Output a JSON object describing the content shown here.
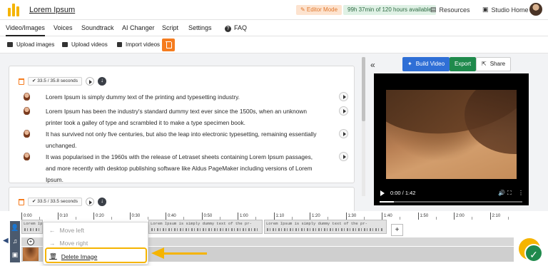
{
  "header": {
    "app_title": "Lorem Ipsum",
    "editor_mode": "✎ Editor Mode",
    "hours_available": "99h 37min of 120 hours available",
    "resources_label": "Resources",
    "studio_home_label": "Studio Home"
  },
  "tabs": [
    "Video/Images",
    "Voices",
    "Soundtrack",
    "AI Changer",
    "Script",
    "Settings",
    "FAQ"
  ],
  "toolbar": {
    "upload_images": "Upload images",
    "upload_videos": "Upload videos",
    "import_videos": "Import videos"
  },
  "script": {
    "scene1_duration": "33.5 / 35.8 seconds",
    "scene2_duration": "33.5 / 33.5 seconds",
    "paragraphs": [
      "Lorem Ipsum is simply dummy text of the printing and typesetting industry.",
      "Lorem Ipsum has been the industry's standard dummy text ever since the 1500s, when an unknown printer took a galley of type and scrambled it to make a type specimen book.",
      "It has survived not only five centuries, but also the leap into electronic typesetting, remaining essentially unchanged.",
      "It was popularised in the 1960s with the release of Letraset sheets containing Lorem Ipsum passages, and more recently with desktop publishing software like Aldus PageMaker including versions of Lorem Ipsum."
    ]
  },
  "preview": {
    "build_label": "Build Video",
    "export_label": "Export",
    "share_label": "Share",
    "time": "0:00 / 1:42",
    "progress": 0.0
  },
  "timeline": {
    "ticks": [
      "0:00",
      "0:10",
      "0:20",
      "0:30",
      "0:40",
      "0:50",
      "1:00",
      "1:10",
      "1:20",
      "1:30",
      "1:40",
      "1:50",
      "2:00",
      "2:10"
    ],
    "clip_text": "Lorem Ipsum is simply dummy text of the pr-"
  },
  "context_menu": {
    "move_left": "Move left",
    "move_right": "Move right",
    "delete_image": "Delete Image"
  },
  "colors": {
    "accent": "#f5b400",
    "primary": "#2f6fd6",
    "success": "#1f8a4c",
    "danger_orange": "#f57c1f"
  }
}
